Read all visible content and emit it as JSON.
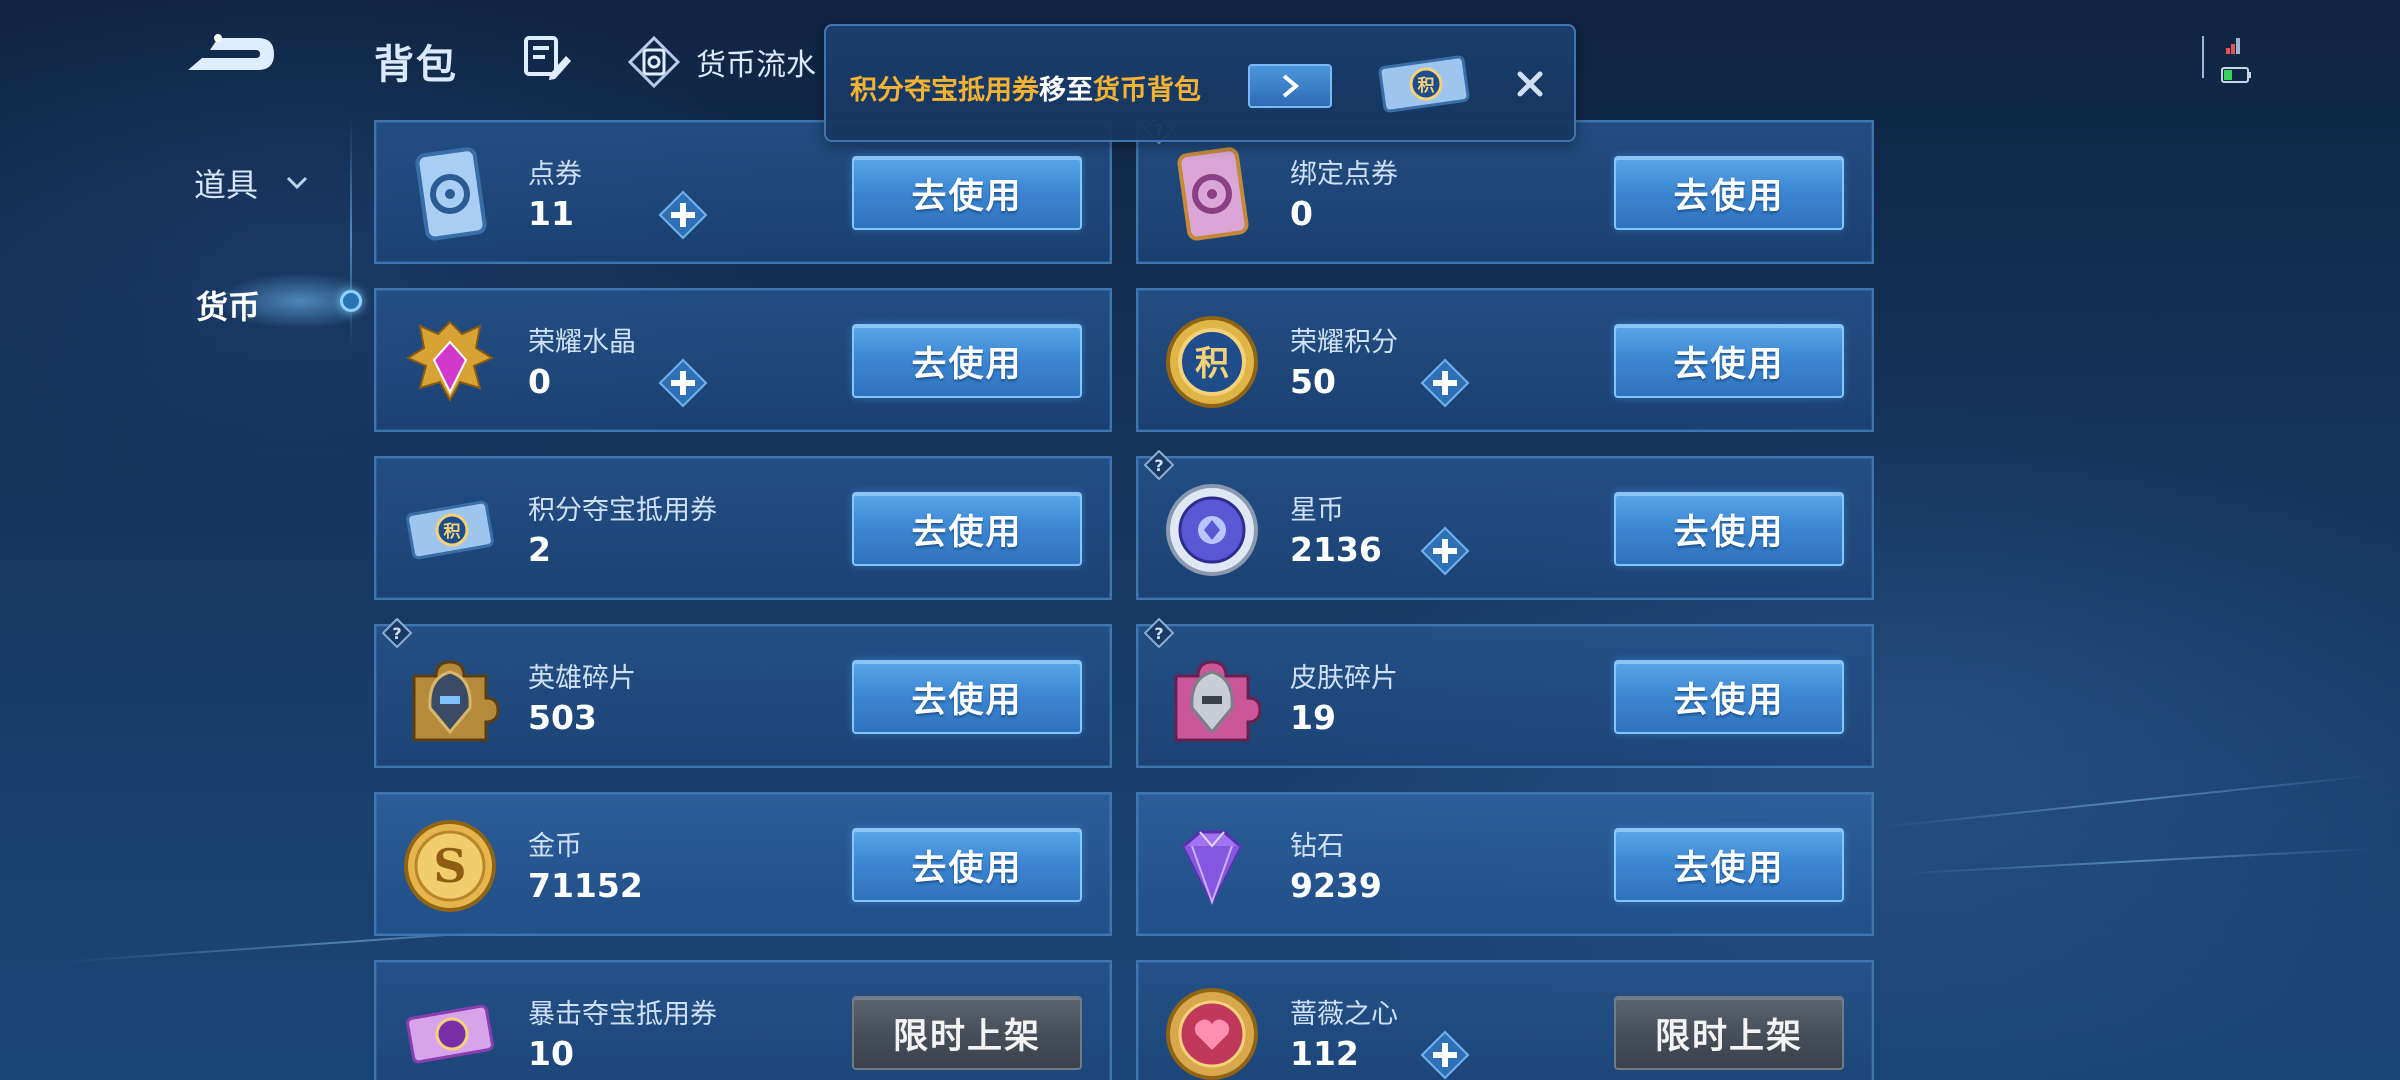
{
  "header": {
    "title": "背包",
    "currency_flow_label": "货币流水"
  },
  "sidebar": {
    "items": [
      {
        "label": "道具"
      },
      {
        "label": "货币"
      }
    ]
  },
  "toast": {
    "part1": "积分夺宝抵用券",
    "part2": "移至",
    "part3": "货币背包"
  },
  "currencies": [
    {
      "name": "点券",
      "count": "11",
      "button": "去使用"
    },
    {
      "name": "绑定点券",
      "count": "0",
      "button": "去使用"
    },
    {
      "name": "荣耀水晶",
      "count": "0",
      "button": "去使用"
    },
    {
      "name": "荣耀积分",
      "count": "50",
      "button": "去使用"
    },
    {
      "name": "积分夺宝抵用券",
      "count": "2",
      "button": "去使用"
    },
    {
      "name": "星币",
      "count": "2136",
      "button": "去使用"
    },
    {
      "name": "英雄碎片",
      "count": "503",
      "button": "去使用"
    },
    {
      "name": "皮肤碎片",
      "count": "19",
      "button": "去使用"
    },
    {
      "name": "金币",
      "count": "71152",
      "button": "去使用"
    },
    {
      "name": "钻石",
      "count": "9239",
      "button": "去使用"
    },
    {
      "name": "暴击夺宝抵用券",
      "count": "10",
      "button": "限时上架"
    },
    {
      "name": "蔷薇之心",
      "count": "112",
      "button": "限时上架"
    }
  ],
  "colors": {
    "accent_blue": "#3d86d1",
    "highlight_orange": "#f5b334",
    "battery_green": "#36d45a"
  }
}
